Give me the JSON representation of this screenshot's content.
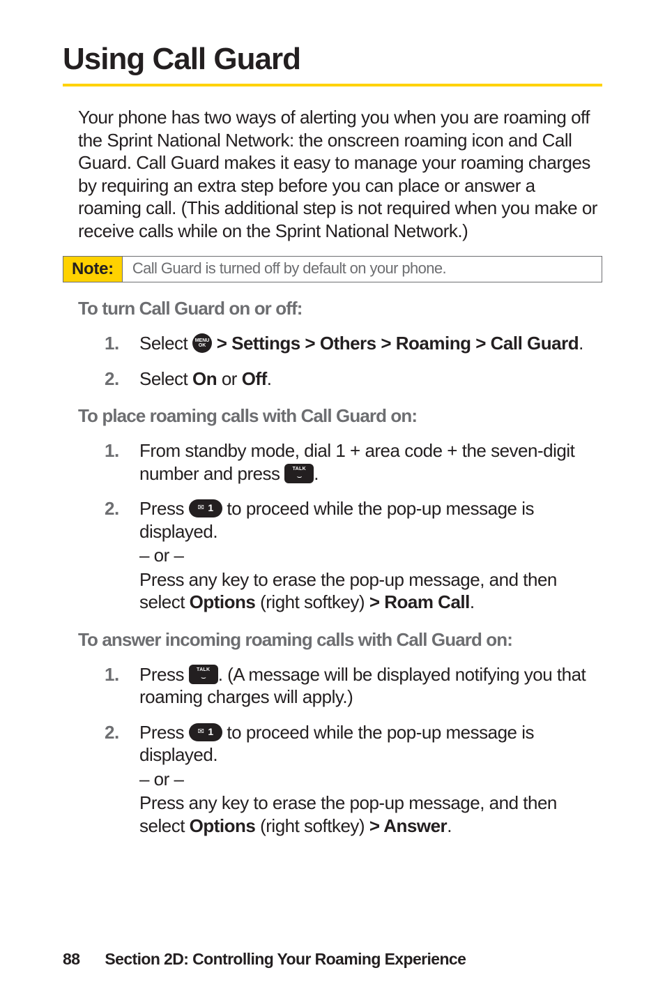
{
  "title": "Using Call Guard",
  "intro": "Your phone has two ways of alerting you when you are roaming off the Sprint National Network: the onscreen roaming icon and Call Guard. Call Guard makes it easy to manage your roaming charges by requiring an extra step before you can place or answer a roaming call. (This additional step is not required when you make or receive calls while on the Sprint National Network.)",
  "note": {
    "label": "Note:",
    "text": "Call Guard is turned off by default on your phone."
  },
  "sub1": "To turn Call Guard on or off:",
  "s1a_pre": "Select ",
  "s1a_nav": " > Settings > Others > Roaming > Call Guard",
  "s1a_post": ".",
  "s1b_pre": "Select ",
  "s1b_on": "On",
  "s1b_mid": " or ",
  "s1b_off": "Off",
  "s1b_post": ".",
  "sub2": "To place roaming calls with Call Guard on:",
  "s2a_pre": "From standby mode, dial 1 + area code + the seven-digit number and press ",
  "s2a_post": ".",
  "s2b_pre": "Press ",
  "s2b_mid": " to proceed while the pop-up message is displayed.",
  "or": "– or –",
  "s2b_alt_pre": "Press any key to erase the pop-up message, and then select ",
  "s2b_opt": "Options",
  "s2b_paren": " (right softkey) ",
  "s2b_roam": "> Roam Call",
  "s2b_alt_post": ".",
  "sub3": "To answer incoming roaming calls with Call Guard on:",
  "s3a_pre": "Press ",
  "s3a_post": ". (A message will be displayed notifying you that roaming charges will apply.)",
  "s3b_pre": "Press ",
  "s3b_mid": " to proceed while the pop-up message is displayed.",
  "s3b_alt_pre": "Press any key to erase the pop-up message, and then select ",
  "s3b_opt": "Options",
  "s3b_paren": " (right softkey) ",
  "s3b_ans": "> Answer",
  "s3b_alt_post": ".",
  "footer": {
    "page": "88",
    "section": "Section 2D: Controlling Your Roaming Experience"
  },
  "icons": {
    "menu_top": "MENU",
    "menu_bot": "OK",
    "talk_label": "TALK",
    "phone": "⌣",
    "envelope": "✉",
    "one": "1"
  }
}
